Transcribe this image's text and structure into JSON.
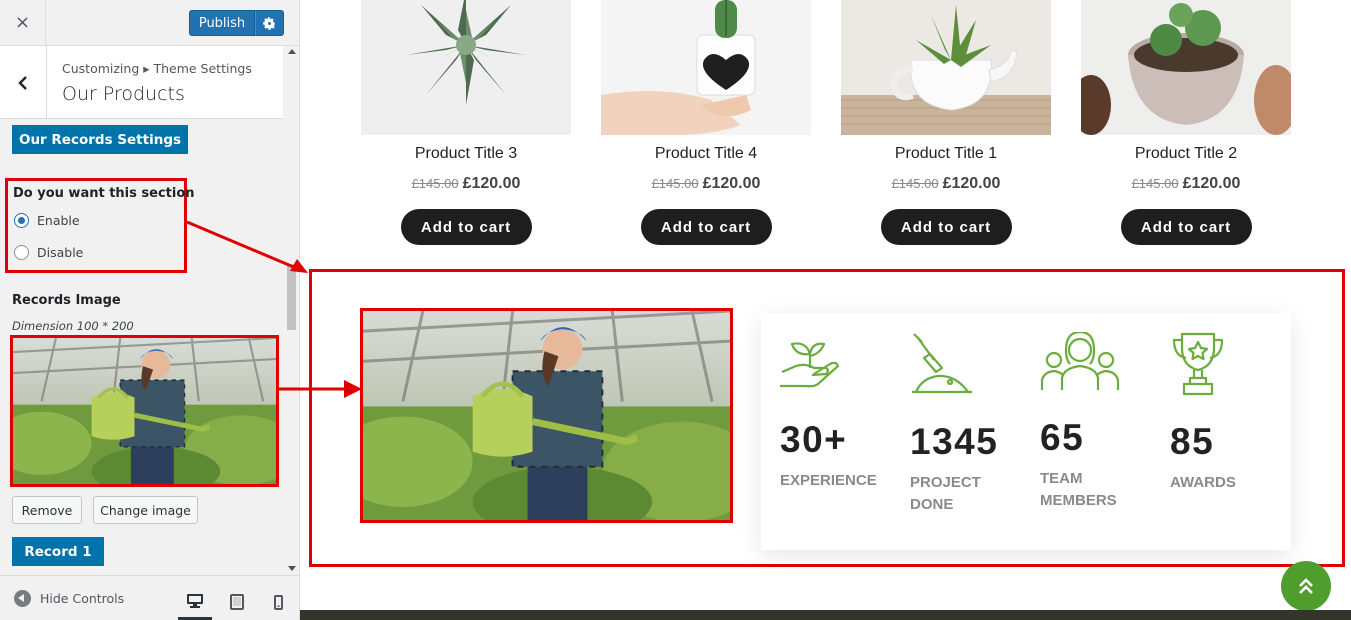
{
  "customizer": {
    "close_label": "×",
    "publish_label": "Publish",
    "breadcrumb": "Customizing ▸ Theme Settings",
    "section_title": "Our Products",
    "records_settings_label": "Our Records Settings",
    "section_toggle": {
      "title": "Do you want this section",
      "options": [
        "Enable",
        "Disable"
      ],
      "selected": "Enable"
    },
    "records_image_label": "Records Image",
    "dimension_note": "Dimension 100 * 200",
    "remove_label": "Remove",
    "change_image_label": "Change image",
    "record1_label": "Record 1",
    "hide_controls_label": "Hide Controls",
    "devices": [
      "desktop-icon",
      "tablet-icon",
      "mobile-icon"
    ],
    "active_device": "desktop"
  },
  "products": [
    {
      "title": "Product Title 3",
      "old_price": "£145.00",
      "price": "£120.00",
      "cart_label": "Add to cart"
    },
    {
      "title": "Product Title 4",
      "old_price": "£145.00",
      "price": "£120.00",
      "cart_label": "Add to cart"
    },
    {
      "title": "Product Title 1",
      "old_price": "£145.00",
      "price": "£120.00",
      "cart_label": "Add to cart"
    },
    {
      "title": "Product Title 2",
      "old_price": "£145.00",
      "price": "£120.00",
      "cart_label": "Add to cart"
    }
  ],
  "records": [
    {
      "number": "30+",
      "label": "EXPERIENCE",
      "icon": "hand-sprout-icon"
    },
    {
      "number": "1345",
      "label": "PROJECT DONE",
      "icon": "shovel-icon"
    },
    {
      "number": "65",
      "label": "TEAM MEMBERS",
      "icon": "team-icon"
    },
    {
      "number": "85",
      "label": "AWARDS",
      "icon": "trophy-icon"
    }
  ],
  "colors": {
    "wp_blue": "#0073aa",
    "highlight_red": "#e00000",
    "accent_green": "#4e9d2d",
    "button_dark": "#1e1e1e"
  }
}
